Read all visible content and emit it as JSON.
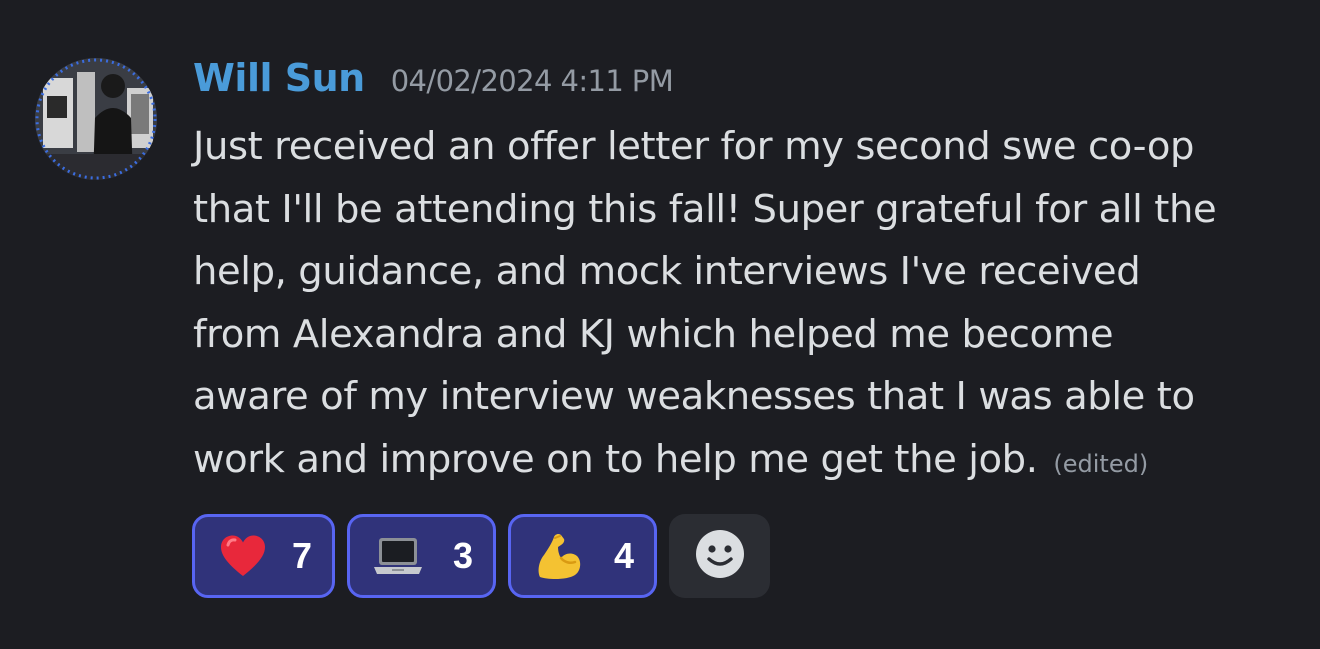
{
  "message": {
    "author": "Will Sun",
    "timestamp": "04/02/2024 4:11 PM",
    "lines": [
      "Just received an offer letter for my second swe co-op",
      "that I'll be attending this fall! Super grateful for all the",
      "help, guidance, and mock interviews I've received",
      "from Alexandra and KJ which helped me become",
      "aware of my interview weaknesses that I was able to",
      "work and improve on to help me get the job."
    ],
    "edited_label": "(edited)"
  },
  "reactions": [
    {
      "emoji": "heart-icon",
      "count": "7"
    },
    {
      "emoji": "laptop-icon",
      "count": "3"
    },
    {
      "emoji": "flexed-biceps-icon",
      "count": "4"
    }
  ],
  "add_reaction": {
    "icon": "smiley-add-reaction-icon"
  },
  "colors": {
    "background": "#1c1d22",
    "username": "#4a9bd9",
    "reaction_active_bg": "#30337a",
    "reaction_active_border": "#5865f2"
  }
}
